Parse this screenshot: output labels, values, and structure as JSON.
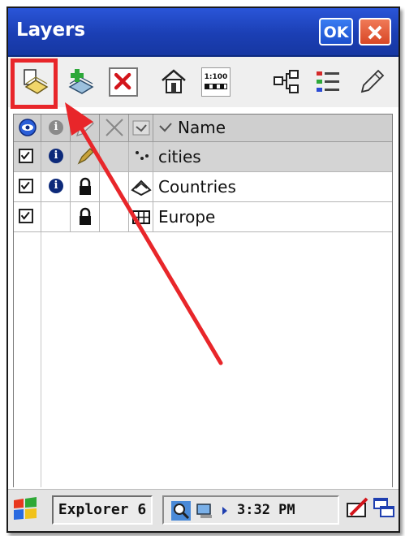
{
  "window": {
    "title": "Layers",
    "ok_label": "OK"
  },
  "toolbar": {
    "buttons": [
      "layer-properties",
      "add-layer",
      "remove-layer",
      "layer-tool",
      "scale",
      "layer-tree",
      "legend",
      "edit"
    ],
    "scale_label": "1:100"
  },
  "grid": {
    "header": {
      "name": "Name"
    },
    "rows": [
      {
        "name": "cities",
        "visible": true,
        "info": true,
        "locked": false,
        "selected": true
      },
      {
        "name": "Countries",
        "visible": true,
        "info": true,
        "locked": true,
        "selected": false
      },
      {
        "name": "Europe",
        "visible": true,
        "info": false,
        "locked": true,
        "selected": false
      }
    ]
  },
  "taskbar": {
    "app_label": "Explorer 6",
    "clock": "3:32 PM"
  },
  "colors": {
    "titlebar": "#1b3fb4",
    "highlight": "#e8262a",
    "arrow": "#e8262a"
  }
}
